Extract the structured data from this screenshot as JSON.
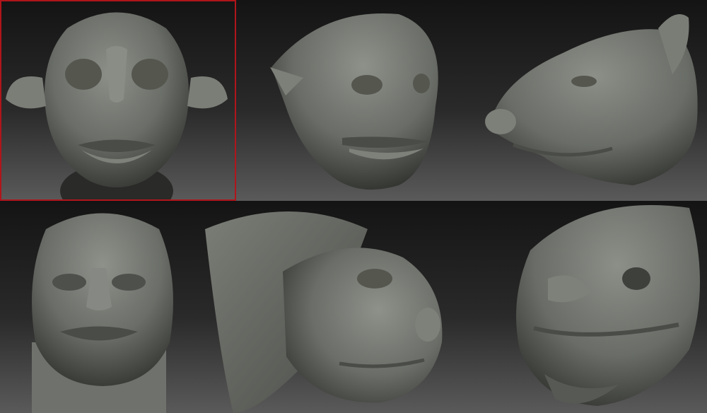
{
  "gallery": {
    "cells": [
      {
        "subject": "head-sculpt-1",
        "selected": true
      },
      {
        "subject": "head-sculpt-2",
        "selected": false
      },
      {
        "subject": "head-sculpt-3",
        "selected": false
      },
      {
        "subject": "head-sculpt-4",
        "selected": false
      },
      {
        "subject": "head-sculpt-5",
        "selected": false
      },
      {
        "subject": "head-sculpt-6",
        "selected": false
      }
    ],
    "colors": {
      "clay": "#6f726c",
      "clay_light": "#8b8e87",
      "clay_dark": "#3f413d",
      "selection": "#b0151b"
    }
  }
}
